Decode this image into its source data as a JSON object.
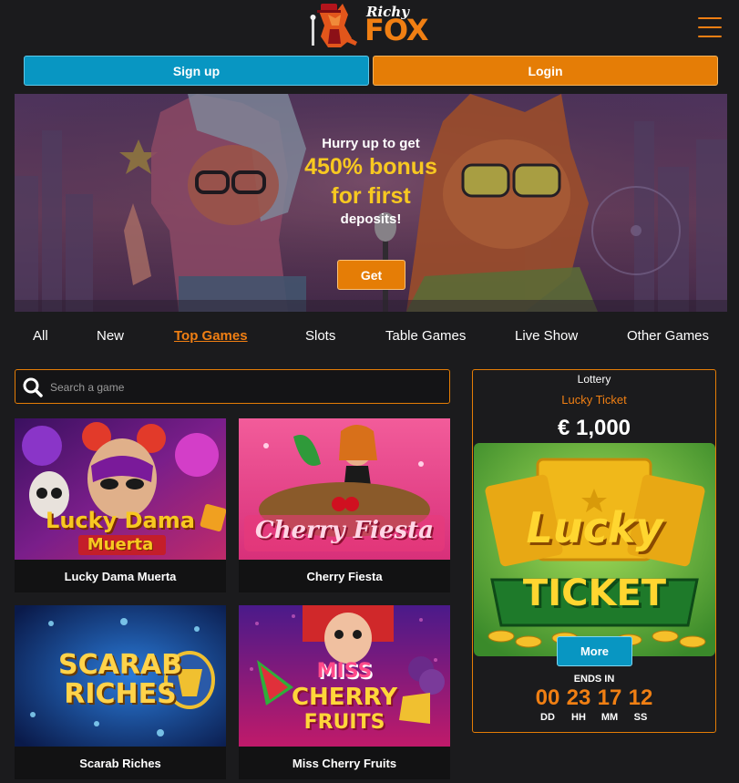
{
  "brand": {
    "logo_top": "Richy",
    "logo_bottom": "FOX"
  },
  "auth": {
    "signup_label": "Sign up",
    "login_label": "Login"
  },
  "banner": {
    "line1": "Hurry up to get",
    "line2": "450% bonus",
    "line3": "for first",
    "line4": "deposits!",
    "cta": "Get"
  },
  "tabs": [
    {
      "label": "All",
      "active": false
    },
    {
      "label": "New",
      "active": false
    },
    {
      "label": "Top Games",
      "active": true
    },
    {
      "label": "Slots",
      "active": false
    },
    {
      "label": "Table Games",
      "active": false
    },
    {
      "label": "Live Show",
      "active": false
    },
    {
      "label": "Other Games",
      "active": false
    }
  ],
  "search": {
    "placeholder": "Search a game",
    "value": ""
  },
  "games": [
    {
      "name": "Lucky Dama Muerta",
      "art_line1": "Lucky Dama",
      "art_line2": "Muerta"
    },
    {
      "name": "Cherry Fiesta",
      "art_line1": "Cherry Fiesta"
    },
    {
      "name": "Scarab Riches",
      "art_line1": "SCARAB",
      "art_line2": "RICHES"
    },
    {
      "name": "Miss Cherry Fruits",
      "art_line1": "MISS",
      "art_line2": "CHERRY",
      "art_line3": "FRUITS"
    }
  ],
  "lottery": {
    "label": "Lottery",
    "name": "Lucky Ticket",
    "amount": "€ 1,000",
    "art_line1": "Lucky",
    "art_line2": "TICKET",
    "more_label": "More",
    "ends_label": "ENDS IN",
    "timer": [
      {
        "value": "00",
        "unit": "DD"
      },
      {
        "value": "23",
        "unit": "HH"
      },
      {
        "value": "17",
        "unit": "MM"
      },
      {
        "value": "12",
        "unit": "SS"
      }
    ]
  },
  "colors": {
    "accent": "#f07f13",
    "signup": "#0896c2",
    "login": "#e57d06",
    "background": "#1b1b1d",
    "gold": "#f7c821"
  }
}
